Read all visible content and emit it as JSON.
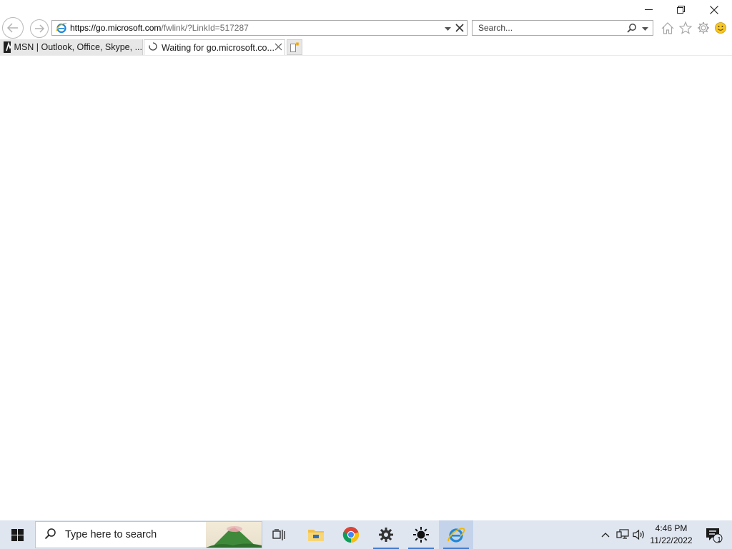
{
  "window": {
    "minimize_icon": "minimize-icon",
    "restore_icon": "restore-icon",
    "close_icon": "close-icon"
  },
  "nav": {
    "back_icon": "back-arrow-icon",
    "forward_icon": "forward-arrow-icon"
  },
  "address_bar": {
    "url_host": "https://go.microsoft.com",
    "url_path": "/fwlink/?LinkId=517287",
    "favicon": "ie-icon"
  },
  "search": {
    "placeholder": "Search..."
  },
  "toolbar": {
    "icons": [
      "home-icon",
      "favorites-star-icon",
      "gear-icon",
      "smiley-feedback-icon"
    ]
  },
  "tabs": [
    {
      "label": "MSN | Outlook, Office, Skype, ...",
      "state": "inactive"
    },
    {
      "label": "Waiting for go.microsoft.co...",
      "state": "active-loading"
    }
  ],
  "taskbar": {
    "search_placeholder": "Type here to search",
    "apps": [
      "task-view-icon",
      "file-explorer-icon",
      "chrome-icon",
      "settings-icon",
      "weather-sun-icon",
      "internet-explorer-icon"
    ],
    "time": "4:46 PM",
    "date": "11/22/2022",
    "notification_count": "1"
  },
  "colors": {
    "taskbar_bg": "#dfe6f0",
    "accent": "#3d7bd0",
    "ie_blue": "#1e88d8"
  }
}
